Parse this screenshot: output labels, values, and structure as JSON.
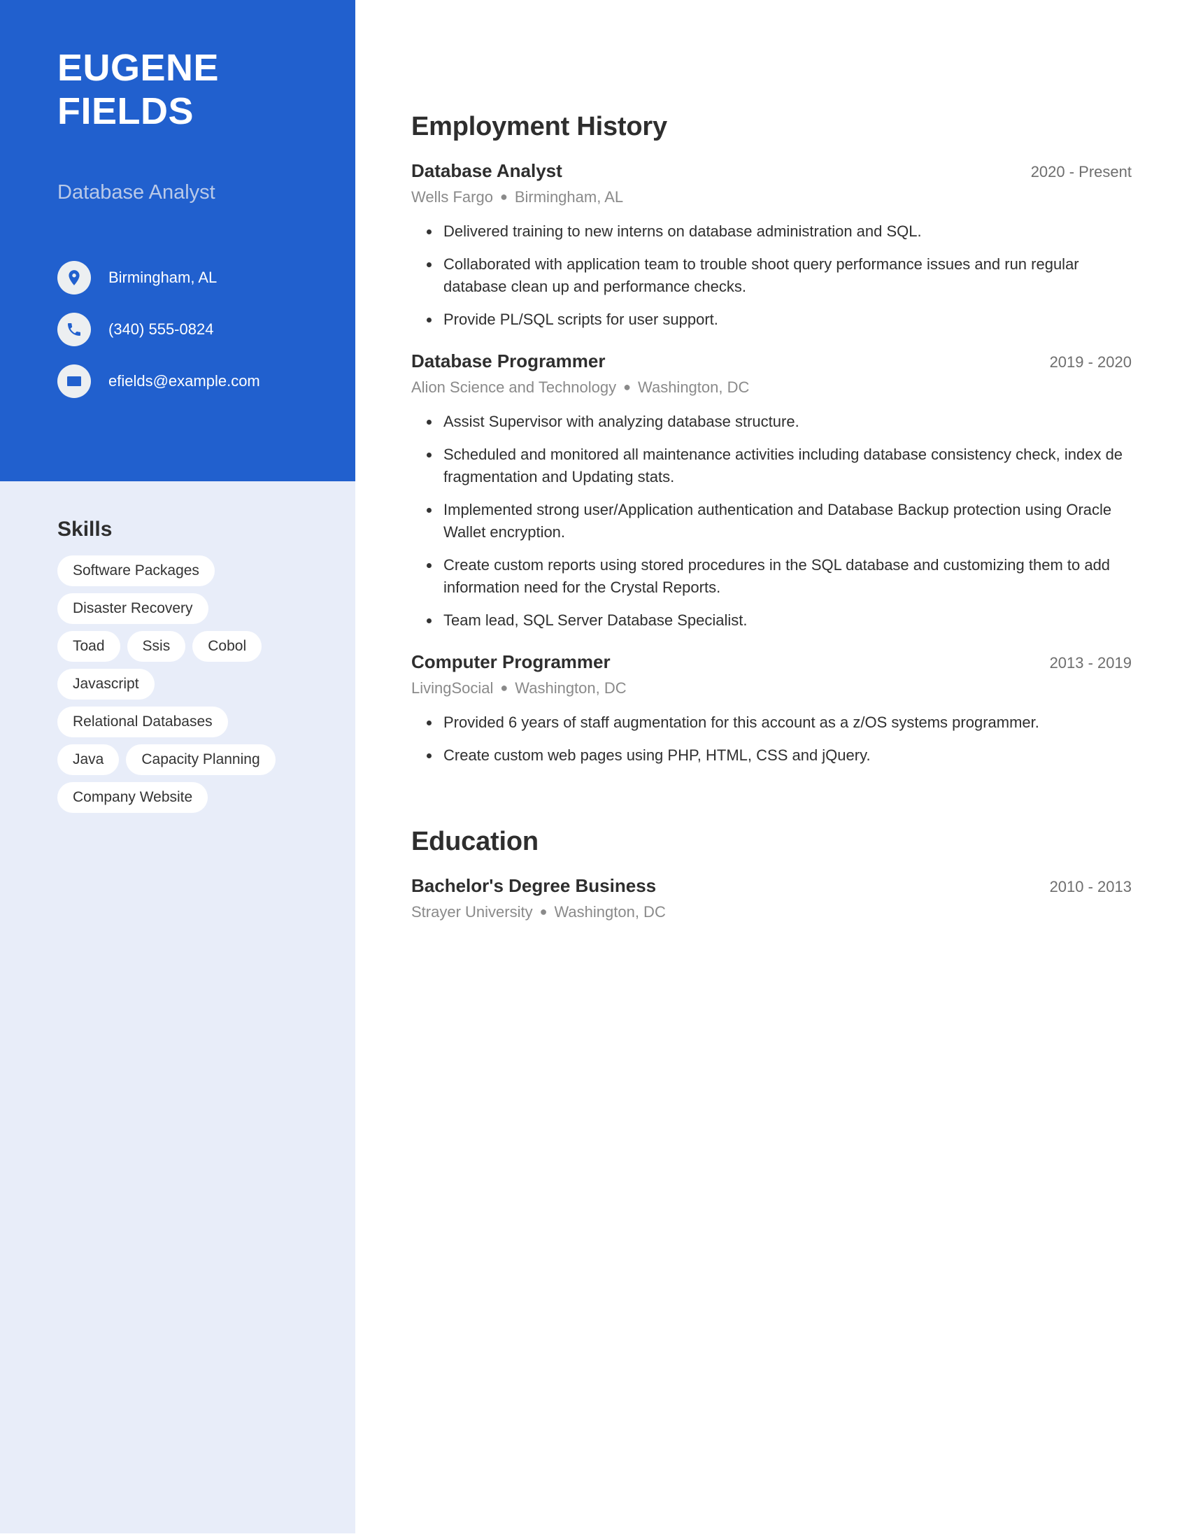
{
  "person": {
    "first_name": "EUGENE",
    "last_name": "FIELDS",
    "job_title": "Database Analyst"
  },
  "contacts": [
    {
      "icon": "location-pin-icon",
      "value": "Birmingham, AL"
    },
    {
      "icon": "phone-icon",
      "value": "(340) 555-0824"
    },
    {
      "icon": "email-icon",
      "value": "efields@example.com"
    }
  ],
  "skills": {
    "heading": "Skills",
    "rows": [
      [
        "Software Packages"
      ],
      [
        "Disaster Recovery"
      ],
      [
        "Toad",
        "Ssis",
        "Cobol"
      ],
      [
        "Javascript"
      ],
      [
        "Relational Databases"
      ],
      [
        "Java",
        "Capacity Planning"
      ],
      [
        "Company Website"
      ]
    ]
  },
  "employment": {
    "heading": "Employment History",
    "entries": [
      {
        "title": "Database Analyst",
        "dates": "2020 - Present",
        "company": "Wells Fargo",
        "location": "Birmingham, AL",
        "bullets": [
          "Delivered training to new interns on database administration and SQL.",
          "Collaborated with application team to trouble shoot query performance issues and run regular database clean up and performance checks.",
          "Provide PL/SQL scripts for user support."
        ]
      },
      {
        "title": "Database Programmer",
        "dates": "2019 - 2020",
        "company": "Alion Science and Technology",
        "location": "Washington, DC",
        "bullets": [
          "Assist Supervisor with analyzing database structure.",
          "Scheduled and monitored all maintenance activities including database consistency check, index de fragmentation and Updating stats.",
          "Implemented strong user/Application authentication and Database Backup protection using Oracle Wallet encryption.",
          "Create custom reports using stored procedures in the SQL database and customizing them to add information need for the Crystal Reports.",
          "Team lead, SQL Server Database Specialist."
        ]
      },
      {
        "title": "Computer Programmer",
        "dates": "2013 - 2019",
        "company": "LivingSocial",
        "location": "Washington, DC",
        "bullets": [
          "Provided 6 years of staff augmentation for this account as a z/OS systems programmer.",
          "Create custom web pages using PHP, HTML, CSS and jQuery."
        ]
      }
    ]
  },
  "education": {
    "heading": "Education",
    "entries": [
      {
        "title": "Bachelor's Degree Business",
        "dates": "2010 - 2013",
        "school": "Strayer University",
        "location": "Washington, DC"
      }
    ]
  },
  "colors": {
    "accent": "#2160ce",
    "sidebar_light": "#e8edf9",
    "text_dark": "#2e2e2e",
    "text_muted": "#8a8a8a"
  }
}
